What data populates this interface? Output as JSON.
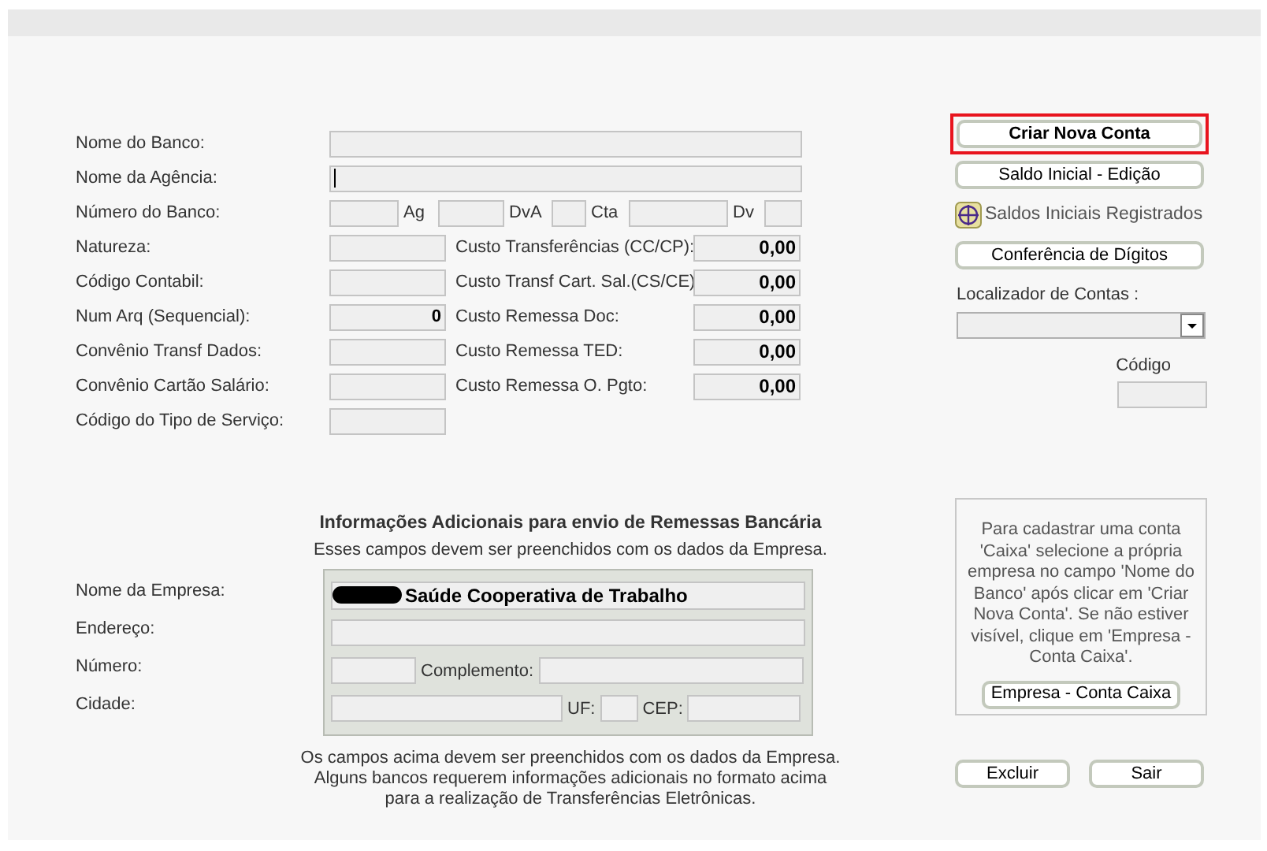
{
  "bank_name": {
    "label": "Nome do Banco:"
  },
  "agency_name": {
    "label": "Nome da Agência:",
    "focused": true
  },
  "bank_number": {
    "label": "Número do Banco:",
    "parts": [
      "Ag",
      "DvA",
      "Cta",
      "Dv"
    ]
  },
  "detail_rows": [
    {
      "label": "Natureza:",
      "cost_label": "Custo Transferências (CC/CP):",
      "cost_value": "0,00"
    },
    {
      "label": "Código Contabil:",
      "cost_label": "Custo Transf Cart. Sal.(CS/CE)",
      "cost_value": "0,00"
    },
    {
      "label": "Num Arq (Sequencial):",
      "value": "0",
      "cost_label": "Custo Remessa Doc:",
      "cost_value": "0,00"
    },
    {
      "label": "Convênio Transf Dados:",
      "cost_label": "Custo Remessa TED:",
      "cost_value": "0,00"
    },
    {
      "label": "Convênio Cartão Salário:",
      "cost_label": "Custo Remessa O. Pgto:",
      "cost_value": "0,00"
    },
    {
      "label": "Código do Tipo de Serviço:"
    }
  ],
  "company": {
    "title": "Informações Adicionais para envio de Remessas Bancária",
    "subtitle": "Esses campos devem ser preenchidos com os dados da Empresa.",
    "name": {
      "label": "Nome da Empresa:",
      "value": "Saúde Cooperativa de Trabalho",
      "redacted_prefix": true
    },
    "address": {
      "label": "Endereço:"
    },
    "number": {
      "label": "Número:",
      "complement_label": "Complemento:"
    },
    "city": {
      "label": "Cidade:",
      "uf_label": "UF:",
      "cep_label": "CEP:"
    },
    "footnote": [
      "Os campos acima devem ser preenchidos com os dados da Empresa.",
      "Alguns bancos requerem informações adicionais no formato acima",
      "para a realização de Transferências Eletrônicas."
    ]
  },
  "actions": {
    "create_button": {
      "label": "Criar Nova Conta",
      "highlighted": true
    },
    "initial_balance_button": {
      "label": "Saldo Inicial - Edição"
    },
    "registered_balances": "Saldos Iniciais Registrados",
    "digits_button": {
      "label": "Conferência de Dígitos"
    },
    "locator_label": "Localizador de Contas :",
    "code_label": "Código"
  },
  "info_box": {
    "text": "Para cadastrar uma conta 'Caixa' selecione a própria empresa no campo 'Nome do Banco' após clicar em 'Criar Nova Conta'. Se não estiver visível, clique em 'Empresa - Conta Caixa'.",
    "button": "Empresa - Conta Caixa"
  },
  "bottom_buttons": [
    "Excluir",
    "Sair"
  ]
}
